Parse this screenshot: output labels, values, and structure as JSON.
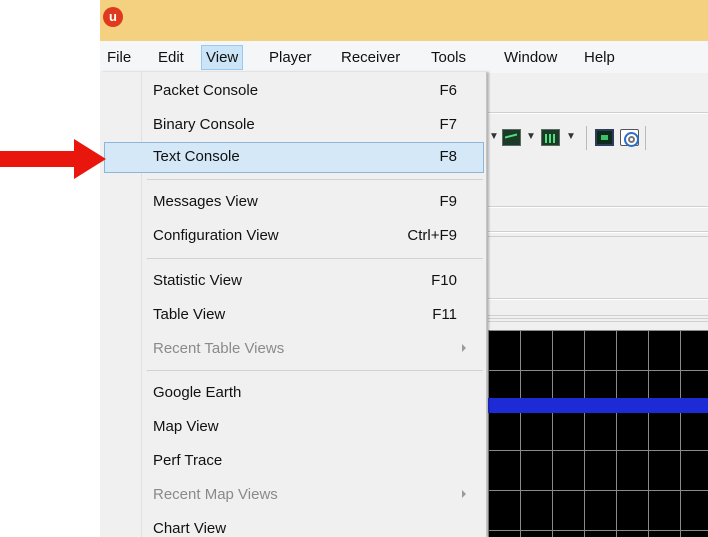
{
  "menubar": {
    "items": [
      {
        "label": "File"
      },
      {
        "label": "Edit"
      },
      {
        "label": "View"
      },
      {
        "label": "Player"
      },
      {
        "label": "Receiver"
      },
      {
        "label": "Tools"
      },
      {
        "label": "Window"
      },
      {
        "label": "Help"
      }
    ],
    "active": "View"
  },
  "app_icon_glyph": "u",
  "view_menu": {
    "items": [
      {
        "label": "Packet Console",
        "shortcut": "F6"
      },
      {
        "label": "Binary Console",
        "shortcut": "F7"
      },
      {
        "label": "Text Console",
        "shortcut": "F8",
        "highlighted": true
      },
      {
        "label": "Messages View",
        "shortcut": "F9"
      },
      {
        "label": "Configuration View",
        "shortcut": "Ctrl+F9"
      },
      {
        "label": "Statistic View",
        "shortcut": "F10"
      },
      {
        "label": "Table View",
        "shortcut": "F11"
      },
      {
        "label": "Recent Table Views",
        "shortcut": "",
        "disabled": true,
        "submenu": true
      },
      {
        "label": "Google Earth",
        "shortcut": ""
      },
      {
        "label": "Map View",
        "shortcut": ""
      },
      {
        "label": "Perf Trace",
        "shortcut": ""
      },
      {
        "label": "Recent Map Views",
        "shortcut": "",
        "disabled": true,
        "submenu": true
      },
      {
        "label": "Chart View",
        "shortcut": ""
      }
    ]
  },
  "colors": {
    "titlebar": "#f3d181",
    "pointer_arrow": "#e8160c",
    "highlight": "#d5e8f7",
    "grid_band": "#1d2bd7"
  },
  "icons": [
    "app-logo-icon",
    "line-chart-icon",
    "bar-chart-icon",
    "console-icon",
    "radar-icon",
    "dropdown-arrow-icon",
    "submenu-arrow-icon",
    "pointer-arrow-icon"
  ]
}
